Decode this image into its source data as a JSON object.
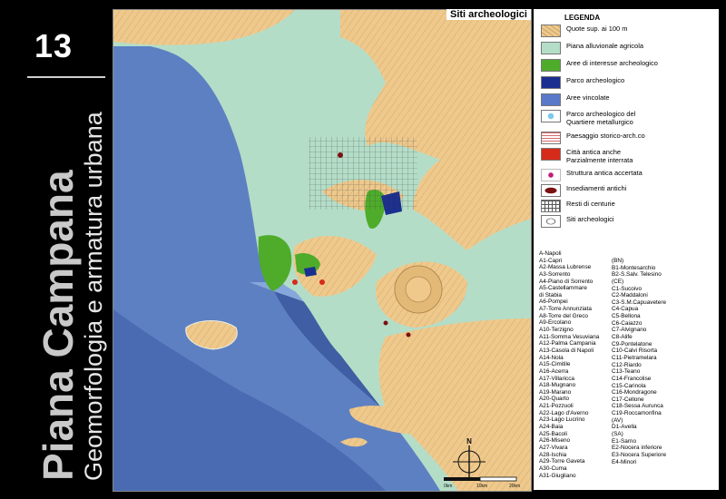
{
  "sheet": {
    "number": "13",
    "title": "Piana Campana",
    "subtitle": "Geomorfologia e armatura urbana"
  },
  "map": {
    "title": "Siti archeologici",
    "colors": {
      "sea_deep": "#3f5ea3",
      "sea_mid": "#5d80c2",
      "sea_shallow": "#86a7db",
      "plain": "#b4ddc8",
      "highland": "#efc98c",
      "archaeo_interest": "#4eac2a",
      "archaeo_park": "#1a2f8f",
      "restricted": "#5a79c9",
      "ancient_city": "#d62a1a",
      "settlement": "#7a1010"
    },
    "scale": {
      "label_left": "0km",
      "label_mid": "10km",
      "label_right": "20km"
    },
    "north": "N"
  },
  "legend": {
    "title": "LEGENDA",
    "items": [
      {
        "label": "Quote sup. ai 100 m",
        "color": "#efc98c",
        "icon": "hatched-highland-swatch"
      },
      {
        "label": "Piana alluvionale agricola",
        "color": "#b4ddc8",
        "icon": "plain-swatch"
      },
      {
        "label": "Aree di interesse archeologico",
        "color": "#4eac2a",
        "icon": "green-swatch"
      },
      {
        "label": "Parco archeologico",
        "color": "#1a2f8f",
        "icon": "dark-blue-swatch"
      },
      {
        "label": "Aree vincolate",
        "color": "#5a79c9",
        "icon": "blue-swatch"
      },
      {
        "label": "Parco archeologico del\nQuartiere metallurgico",
        "color": "#ffffff",
        "icon": "light-blue-dot-swatch"
      },
      {
        "label": "Paesaggio storico-arch.co",
        "color": "#ffffff",
        "icon": "red-lines-swatch"
      },
      {
        "label": "Città antica anche\nParzialmente interrata",
        "color": "#d62a1a",
        "icon": "red-swatch"
      },
      {
        "label": "Struttura antica accertata",
        "color": "#ffffff",
        "icon": "magenta-dot-swatch"
      },
      {
        "label": "Insediamenti antichi",
        "color": "#7a1010",
        "icon": "settlement-swatch"
      },
      {
        "label": "Resti di centurie",
        "color": "#ffffff",
        "icon": "grid-swatch"
      },
      {
        "label": "Siti archeologici",
        "color": "#ffffff",
        "icon": "site-outline-swatch"
      }
    ],
    "codes_left": [
      "A-Napoli",
      "A1-Capri",
      "A2-Massa Lubrense",
      "A3-Sorrento",
      "A4-Piano di Sorrento",
      "A5-Castellammare",
      "di Stabia",
      "A6-Pompei",
      "A7-Torre Annunziata",
      "A8-Torre del Greco",
      "A9-Ercolano",
      "A10-Terzigno",
      "A11-Somma Vesuviana",
      "A12-Palma Campania",
      "A13-Casola di Napoli",
      "A14-Nola",
      "A15-Cimitile",
      "A16-Acerra",
      "A17-Villaricca",
      "A18-Mugnano",
      "A19-Marano",
      "A20-Quarto",
      "A21-Pozzuoli",
      "A22-Lago d'Averno",
      "A23-Lago Lucrino",
      "A24-Baia",
      "A25-Bacoli",
      "A26-Miseno",
      "A27-Vivara",
      "A28-Ischia",
      "A29-Torre Gaveta",
      "A30-Cuma",
      "A31-Giugliano"
    ],
    "codes_right": [
      "(BN)",
      "B1-Montesarchio",
      "B2-S.Salv. Telesino",
      "(CE)",
      "C1-Sucoivo",
      "C2-Maddaloni",
      "C3-S.M.Capuavetere",
      "C4-Capua",
      "C5-Bellona",
      "C6-Caiazzo",
      "C7-Alvignano",
      "C8-Alife",
      "C9-Pontelatone",
      "C10-Calvi Risorta",
      "C11-Pietramelara",
      "C12-Riardo",
      "C13-Teano",
      "C14-Francolise",
      "C15-Carinola",
      "C16-Mondragone",
      "C17-Cellone",
      "C18-Sessa Aurunca",
      "C19-Roccamonfina",
      "(AV)",
      "D1-Avella",
      "(SA)",
      "E1-Sarno",
      "E2-Nocera inferiore",
      "E3-Nocera Superiore",
      "E4-Minori"
    ]
  }
}
